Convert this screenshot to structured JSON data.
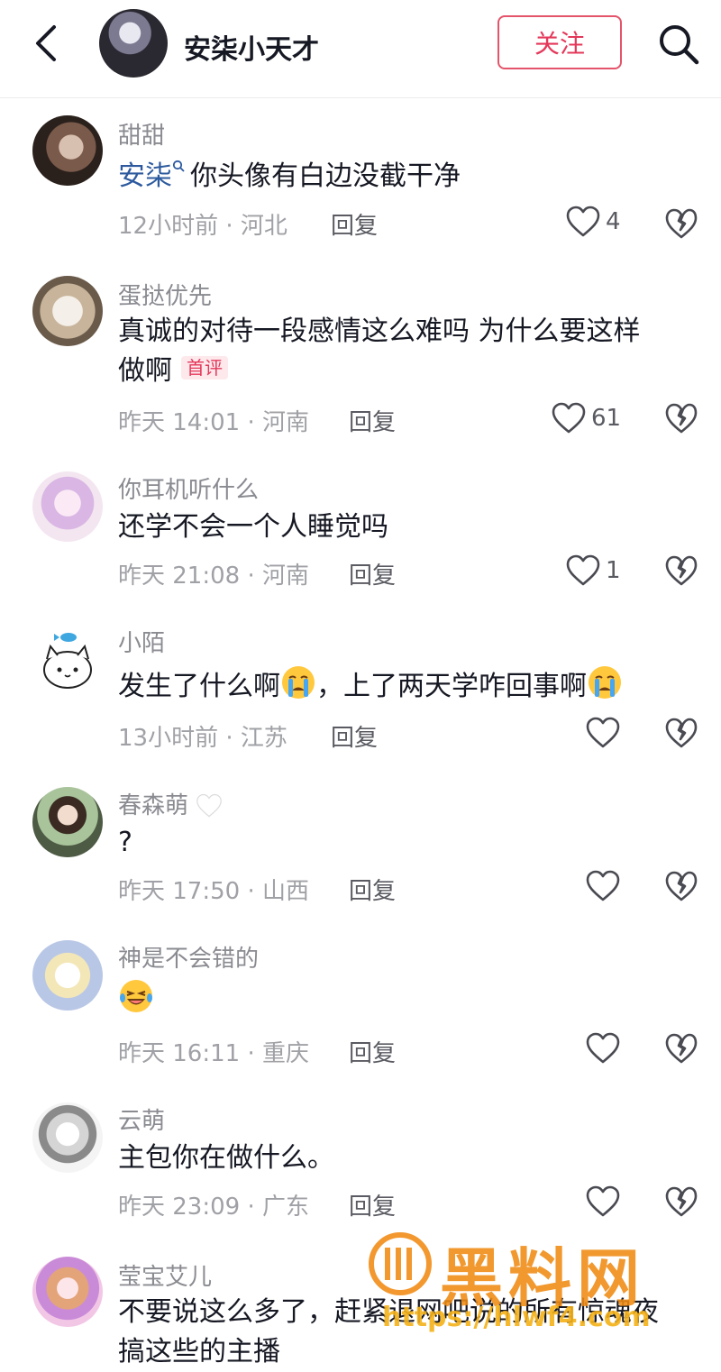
{
  "header": {
    "title": "安柒小天才",
    "follow_label": "关注"
  },
  "comments": [
    {
      "username": "甜甜",
      "mention": "安柒",
      "text": "你头像有白边没截干净",
      "time": "12小时前 · 河北",
      "reply": "回复",
      "likes": "4"
    },
    {
      "username": "蛋挞优先",
      "text_line1": "真诚的对待一段感情这么难吗 为什么要这样",
      "text_line2": "做啊",
      "tag": "首评",
      "time": "昨天 14:01 · 河南",
      "reply": "回复",
      "likes": "61"
    },
    {
      "username": "你耳机听什么",
      "text": "还学不会一个人睡觉吗",
      "time": "昨天 21:08 · 河南",
      "reply": "回复",
      "likes": "1"
    },
    {
      "username": "小陌",
      "text_part1": "发生了什么啊",
      "text_part2": "，上了两天学咋回事啊",
      "time": "13小时前 · 江苏",
      "reply": "回复"
    },
    {
      "username": "春森萌",
      "text": "?",
      "time": "昨天 17:50 · 山西",
      "reply": "回复"
    },
    {
      "username": "神是不会错的",
      "time": "昨天 16:11 · 重庆",
      "reply": "回复"
    },
    {
      "username": "云萌",
      "text": "主包你在做什么。",
      "time": "昨天 23:09 · 广东",
      "reply": "回复"
    },
    {
      "username": "莹宝艾儿",
      "text_line1": "不要说这么多了，赶紧退网吧说的所有惊魂夜",
      "text_line2": "搞这些的主播"
    }
  ],
  "watermark": {
    "title": "黑料网",
    "url": "https://hlwf4.com"
  },
  "colors": {
    "accent": "#e4385a",
    "mention": "#2d5a9e",
    "meta_text": "#a0a1a6",
    "username_text": "#8a8b91"
  }
}
